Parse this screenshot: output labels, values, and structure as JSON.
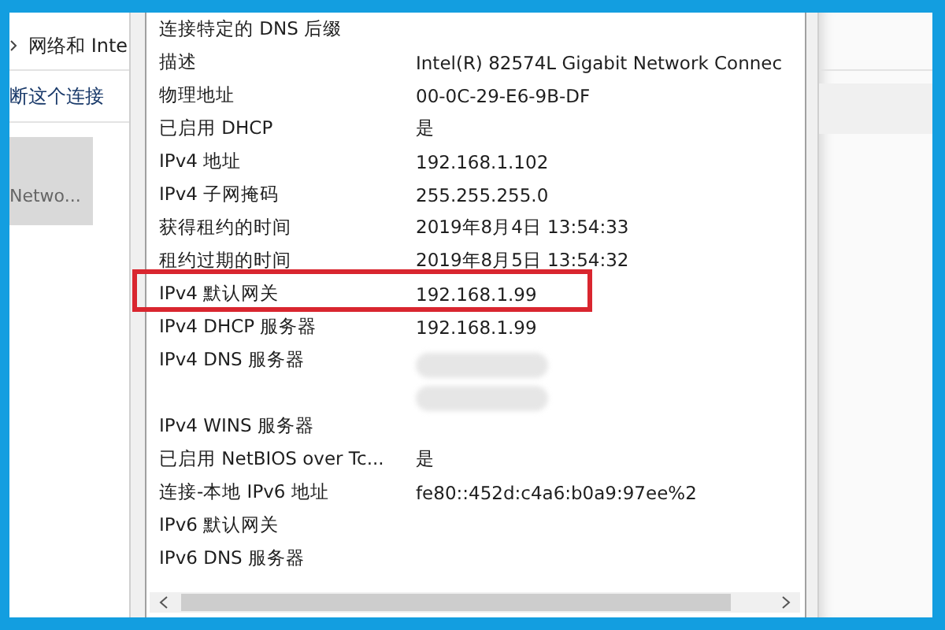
{
  "background_window": {
    "breadcrumb": "网络和 Inte",
    "command": "断这个连接",
    "adapter_tile": {
      "label": "Netwo..."
    }
  },
  "details": {
    "rows": [
      {
        "label": "连接特定的 DNS 后缀",
        "value": "",
        "highlighted": false,
        "redacted": false
      },
      {
        "label": "描述",
        "value": "Intel(R) 82574L Gigabit Network Connec",
        "highlighted": false,
        "redacted": false
      },
      {
        "label": "物理地址",
        "value": "00-0C-29-E6-9B-DF",
        "highlighted": false,
        "redacted": false
      },
      {
        "label": "已启用 DHCP",
        "value": "是",
        "highlighted": false,
        "redacted": false
      },
      {
        "label": "IPv4 地址",
        "value": "192.168.1.102",
        "highlighted": false,
        "redacted": false
      },
      {
        "label": "IPv4 子网掩码",
        "value": "255.255.255.0",
        "highlighted": false,
        "redacted": false
      },
      {
        "label": "获得租约的时间",
        "value": "2019年8月4日 13:54:33",
        "highlighted": false,
        "redacted": false
      },
      {
        "label": "租约过期的时间",
        "value": "2019年8月5日 13:54:32",
        "highlighted": false,
        "redacted": false
      },
      {
        "label": "IPv4 默认网关",
        "value": "192.168.1.99",
        "highlighted": true,
        "redacted": false
      },
      {
        "label": "IPv4 DHCP 服务器",
        "value": "192.168.1.99",
        "highlighted": false,
        "redacted": false
      },
      {
        "label": "IPv4 DNS 服务器",
        "value": "",
        "highlighted": false,
        "redacted": true
      },
      {
        "label": "",
        "value": "",
        "highlighted": false,
        "redacted": true
      },
      {
        "label": "IPv4 WINS 服务器",
        "value": "",
        "highlighted": false,
        "redacted": false
      },
      {
        "label": "已启用 NetBIOS over Tc...",
        "value": "是",
        "highlighted": false,
        "redacted": false
      },
      {
        "label": "连接-本地 IPv6 地址",
        "value": "fe80::452d:c4a6:b0a9:97ee%2",
        "highlighted": false,
        "redacted": false
      },
      {
        "label": "IPv6 默认网关",
        "value": "",
        "highlighted": false,
        "redacted": false
      },
      {
        "label": "IPv6 DNS 服务器",
        "value": "",
        "highlighted": false,
        "redacted": false
      }
    ]
  }
}
